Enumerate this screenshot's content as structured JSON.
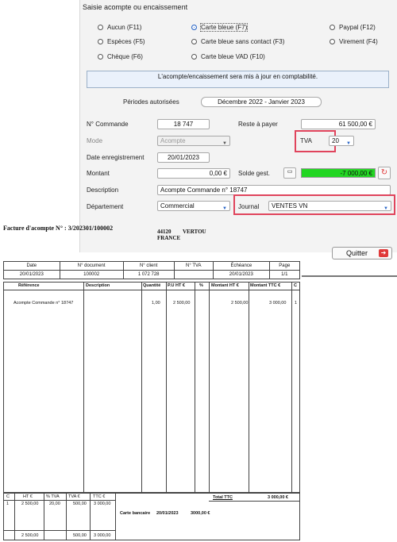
{
  "dialog": {
    "title": "Saisie acompte ou encaissement",
    "radios": [
      {
        "label": "Aucun (F11)",
        "selected": false
      },
      {
        "label": "Carte bleue (F7)",
        "selected": true
      },
      {
        "label": "Paypal (F12)",
        "selected": false
      },
      {
        "label": "Espèces (F5)",
        "selected": false
      },
      {
        "label": "Carte bleue sans contact (F3)",
        "selected": false
      },
      {
        "label": "Virement (F4)",
        "selected": false
      },
      {
        "label": "Chèque (F6)",
        "selected": false
      },
      {
        "label": "Carte bleue VAD (F10)",
        "selected": false
      }
    ],
    "info_message": "L'acompte/encaissement sera mis à jour en comptabilité.",
    "periodes_label": "Périodes autorisées",
    "periodes_value": "Décembre 2022 - Janvier 2023",
    "commande_label": "N° Commande",
    "commande_value": "18 747",
    "reste_label": "Reste à payer",
    "reste_value": "61 500,00 €",
    "mode_label": "Mode",
    "mode_value": "Acompte",
    "tva_label": "TVA",
    "tva_value": "20",
    "date_label": "Date enregistrement",
    "date_value": "20/01/2023",
    "montant_label": "Montant",
    "montant_value": "0,00 €",
    "solde_label": "Solde gest.",
    "solde_value": "-7 000,00 €",
    "description_label": "Description",
    "description_value": "Acompte Commande n° 18747",
    "departement_label": "Département",
    "departement_value": "Commercial",
    "journal_label": "Journal",
    "journal_value": "VENTES VN",
    "quit_label": "Quitter",
    "highlight_color": "#e0445c",
    "solde_color": "#22d622"
  },
  "invoice": {
    "title": "Facture d'acompte N° : 3/202301/100002",
    "address_line1": "44120",
    "address_city": "VERTOU",
    "address_country": "FRANCE",
    "header_labels": [
      "Date",
      "N° document",
      "N° client",
      "N° TVA",
      "Échéance",
      "Page"
    ],
    "header_values": [
      "20/01/2023",
      "100002",
      "1 072 728",
      "",
      "20/01/2023",
      "1/1"
    ],
    "columns": [
      "Référence",
      "Description",
      "Quantité",
      "P.U HT   €",
      "%",
      "Montant HT   €",
      "Montant TTC   €",
      "C"
    ],
    "line": {
      "reference": "Acompte Commande n° 18747",
      "quantite": "1,00",
      "pu": "2 500,00",
      "montant_ht": "2 500,00",
      "montant_ttc": "3 000,00",
      "c": "1"
    },
    "footer_headers": [
      "C",
      "HT   €",
      "% TVA",
      "TVA   €",
      "TTC   €"
    ],
    "footer_row1": [
      "1",
      "2 500,00",
      "20,00",
      "500,00",
      "3 000,00"
    ],
    "footer_row2": [
      "",
      "2 500,00",
      "",
      "500,00",
      "3 000,00"
    ],
    "total_ttc_label": "Total TTC",
    "total_ttc_value": "3 000,00 €",
    "payment_label": "Carte bancaire",
    "payment_date": "20/01/2023",
    "payment_amount": "3000,00 €"
  }
}
